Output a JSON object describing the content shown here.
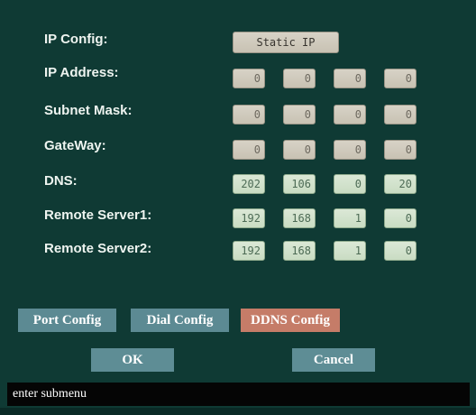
{
  "form": {
    "ip_config_label": "IP Config:",
    "ip_config_value": "Static IP",
    "ip_address_label": "IP Address:",
    "ip_address": [
      "0",
      "0",
      "0",
      "0"
    ],
    "subnet_mask_label": "Subnet Mask:",
    "subnet_mask": [
      "0",
      "0",
      "0",
      "0"
    ],
    "gateway_label": "GateWay:",
    "gateway": [
      "0",
      "0",
      "0",
      "0"
    ],
    "dns_label": "DNS:",
    "dns": [
      "202",
      "106",
      "0",
      "20"
    ],
    "remote_server1_label": "Remote Server1:",
    "remote_server1": [
      "192",
      "168",
      "1",
      "0"
    ],
    "remote_server2_label": "Remote Server2:",
    "remote_server2": [
      "192",
      "168",
      "1",
      "0"
    ]
  },
  "tabs": {
    "port_config": "Port Config",
    "dial_config": "Dial Config",
    "ddns_config": "DDNS Config",
    "active": "DDNS Config"
  },
  "actions": {
    "ok": "OK",
    "cancel": "Cancel"
  },
  "status": "enter submenu",
  "colors": {
    "panel": "#0f3a34",
    "tab": "#5c8a93",
    "tab_active": "#c57c68",
    "button": "#5e8d95"
  }
}
